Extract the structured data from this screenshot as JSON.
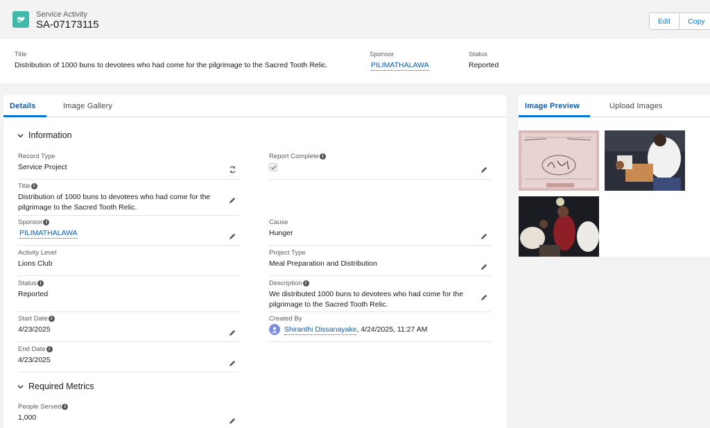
{
  "header": {
    "object_type": "Service Activity",
    "record_name": "SA-07173115",
    "edit_label": "Edit",
    "copy_label": "Copy"
  },
  "highlights": {
    "title_label": "Title",
    "title_value": "Distribution of 1000 buns to devotees who had come for the pilgrimage to the Sacred Tooth Relic.",
    "sponsor_label": "Sponsor",
    "sponsor_value": "PILIMATHALAWA",
    "status_label": "Status",
    "status_value": "Reported"
  },
  "main_tabs": [
    "Details",
    "Image Gallery"
  ],
  "sections": {
    "information": "Information",
    "required_metrics": "Required Metrics"
  },
  "fields": {
    "record_type": {
      "label": "Record Type",
      "value": "Service Project"
    },
    "report_complete": {
      "label": "Report Complete",
      "checked": true
    },
    "title": {
      "label": "Title",
      "value": "Distribution of 1000 buns to devotees who had come for the pilgrimage to the Sacred Tooth Relic."
    },
    "sponsor": {
      "label": "Sponsor",
      "value": "PILIMATHALAWA"
    },
    "cause": {
      "label": "Cause",
      "value": "Hunger"
    },
    "activity_level": {
      "label": "Activity Level",
      "value": "Lions Club"
    },
    "project_type": {
      "label": "Project Type",
      "value": "Meal Preparation and Distribution"
    },
    "status": {
      "label": "Status",
      "value": "Reported"
    },
    "description": {
      "label": "Description",
      "value": "We distributed 1000 buns to devotees who had come for the pilgrimage to the Sacred Tooth Relic."
    },
    "start_date": {
      "label": "Start Date",
      "value": "4/23/2025"
    },
    "created_by": {
      "label": "Created By",
      "user": "Shiranthi Dissanayake",
      "timestamp": ", 4/24/2025, 11:27 AM"
    },
    "end_date": {
      "label": "End Date",
      "value": "4/23/2025"
    },
    "people_served": {
      "label": "People Served",
      "value": "1,000"
    }
  },
  "side_tabs": [
    "Image Preview",
    "Upload Images"
  ],
  "colors": {
    "accent": "#0176d3",
    "link": "#0b5cab",
    "record_icon": "#3fb9a8",
    "page_bg": "#f3f3f3"
  }
}
